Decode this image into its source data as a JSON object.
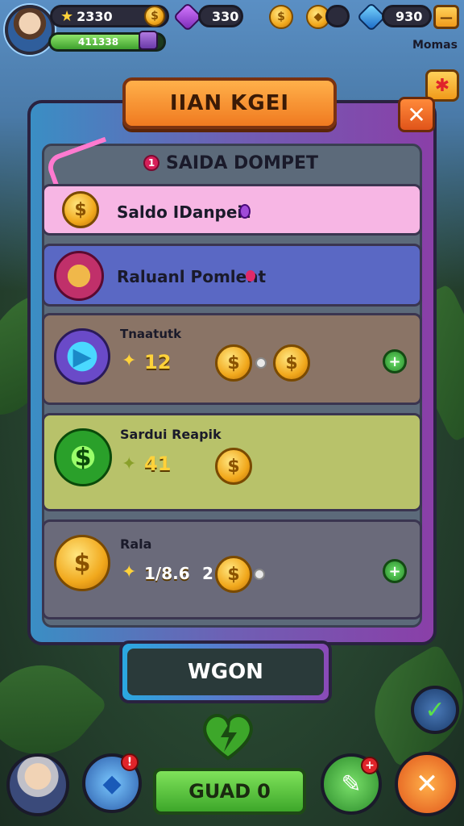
{
  "hud": {
    "coins": "2330",
    "xp_text": "411338",
    "gems_purple": "330",
    "gems_blue": "930",
    "side_label": "Momas",
    "xp_fraction": 0.78
  },
  "panel": {
    "title": "IIAN KGEI",
    "section_number": "1",
    "section_title": "SAIDA DOMPET",
    "rows": [
      {
        "label": "Saldo IDanpeit",
        "bg": "#f7b6e4"
      },
      {
        "label": "Raluanl Pomlent",
        "bg": "#5a68c4"
      },
      {
        "label": "Tnaatutk",
        "value": "12",
        "bg": "#8a7466"
      },
      {
        "label": "Sardui Reapik",
        "value": "41",
        "bg": "#b8c26a"
      },
      {
        "label": "Rala",
        "value": "1/8.6",
        "separator": "2",
        "bg": "#6a6a7a"
      }
    ]
  },
  "buttons": {
    "wgon": "WGON",
    "guad": "GUAD",
    "close": "✕",
    "guad_suffix": "0"
  },
  "colors": {
    "accent_orange": "#f07a20",
    "accent_green": "#3da72a"
  }
}
